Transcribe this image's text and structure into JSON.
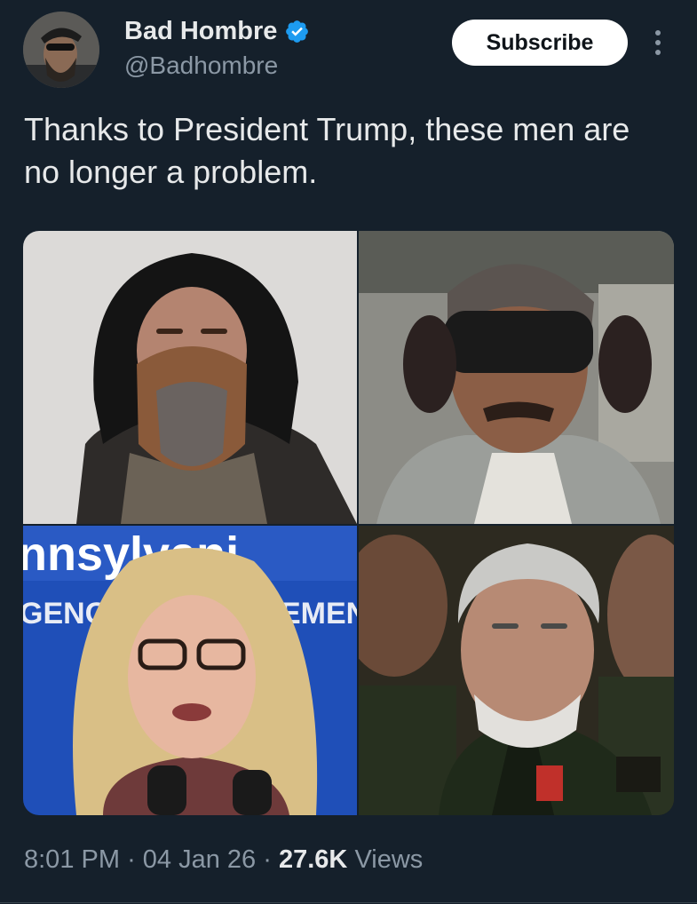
{
  "author": {
    "display_name": "Bad Hombre",
    "handle": "@Badhombre",
    "verified": true,
    "verified_color": "#1d9bf0"
  },
  "actions": {
    "subscribe_label": "Subscribe"
  },
  "post": {
    "text": "Thanks to President Trump, these men are no longer a problem.",
    "media": [
      {
        "description": "bearded man in black hood"
      },
      {
        "description": "blindfolded man with headphones and moustache"
      },
      {
        "description": "person with long blonde hair and glasses at a microphone"
      },
      {
        "description": "grey-haired man in military uniform"
      }
    ],
    "media_sign_text": {
      "line1": "nnsylvani",
      "line2": "GENC",
      "line3": "EMEN"
    }
  },
  "meta": {
    "time": "8:01 PM",
    "separator": "·",
    "date": "04 Jan 26",
    "views_count": "27.6K",
    "views_label": "Views"
  },
  "colors": {
    "background": "#15202b",
    "text_primary": "#e7e9ea",
    "text_secondary": "#8b98a5",
    "button_bg": "#ffffff"
  }
}
